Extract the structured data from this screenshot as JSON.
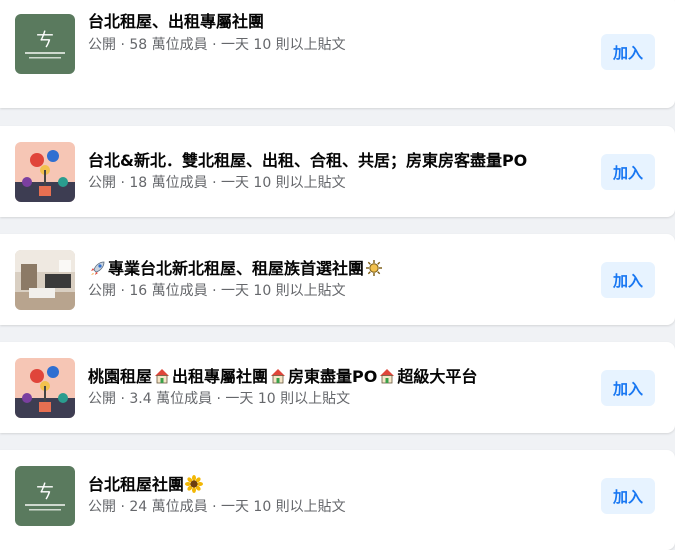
{
  "groups": [
    {
      "title_parts": [
        "台北租屋、出租專屬社團"
      ],
      "meta": "公開 · 58 萬位成員 · 一天 10 則以上貼文",
      "join_label": "加入",
      "thumb": "logo-green",
      "logo_text": "ㄘ"
    },
    {
      "title_parts": [
        "台北&新北．雙北租屋、出租、合租、共居；房東房客盡量PO"
      ],
      "meta": "公開 · 18 萬位成員 · 一天 10 則以上貼文",
      "join_label": "加入",
      "thumb": "illustration"
    },
    {
      "title_parts": [
        "專業台北新北租屋、租屋族首選社團"
      ],
      "meta": "公開 · 16 萬位成員 · 一天 10 則以上貼文",
      "join_label": "加入",
      "thumb": "room-photo",
      "leading_icon": "rocket-icon",
      "trailing_icon": "sun-icon"
    },
    {
      "title_parts": [
        "桃園租屋",
        "出租專屬社團",
        "房東盡量PO",
        "超級大平台"
      ],
      "meta": "公開 · 3.4 萬位成員 · 一天 10 則以上貼文",
      "join_label": "加入",
      "thumb": "illustration",
      "separator_icon": "house-icon"
    },
    {
      "title_parts": [
        "台北租屋社團"
      ],
      "meta": "公開 · 24 萬位成員 · 一天 10 則以上貼文",
      "join_label": "加入",
      "thumb": "logo-green",
      "logo_text": "ㄘ",
      "trailing_icon": "sunflower-icon"
    }
  ],
  "colors": {
    "accent": "#1877f2",
    "button_bg": "#e7f3ff",
    "logo_green": "#5a7a5e",
    "meta_text": "#65676b"
  }
}
